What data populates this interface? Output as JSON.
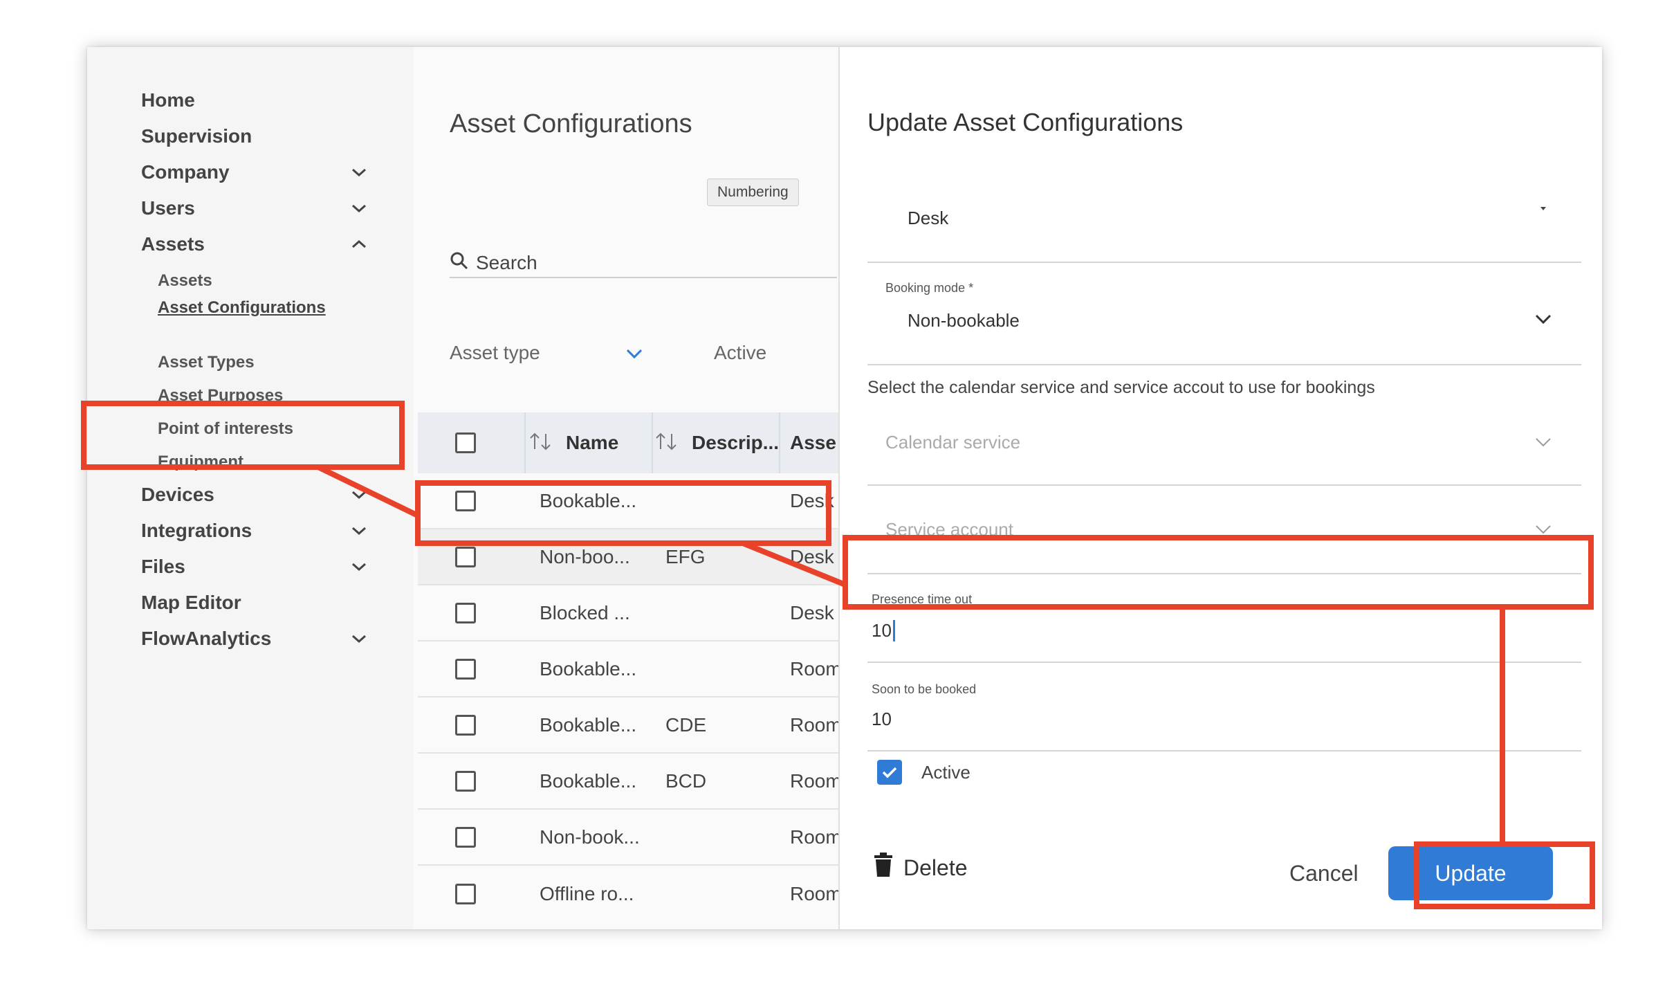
{
  "sidebar": {
    "items": [
      {
        "label": "Home"
      },
      {
        "label": "Supervision"
      },
      {
        "label": "Company"
      },
      {
        "label": "Users"
      },
      {
        "label": "Assets"
      },
      {
        "label": "Devices"
      },
      {
        "label": "Integrations"
      },
      {
        "label": "Files"
      },
      {
        "label": "Map Editor"
      },
      {
        "label": "FlowAnalytics"
      }
    ],
    "asset_sub_items": [
      {
        "label": "Assets"
      },
      {
        "label": "Asset Configurations"
      },
      {
        "label": "Asset Types"
      },
      {
        "label": "Asset Purposes"
      },
      {
        "label": "Point of interests"
      },
      {
        "label": "Equipment"
      }
    ]
  },
  "list": {
    "title": "Asset Configurations",
    "tooltip": "Numbering",
    "search_placeholder": "Search",
    "filters": {
      "asset_type": "Asset type",
      "active": "Active"
    },
    "columns": [
      "Name",
      "Descrip...",
      "Asse"
    ],
    "rows": [
      {
        "name": "Bookable...",
        "desc": "",
        "type": "Desk"
      },
      {
        "name": "Non-boo...",
        "desc": "EFG",
        "type": "Desk"
      },
      {
        "name": "Blocked ...",
        "desc": "",
        "type": "Desk"
      },
      {
        "name": "Bookable...",
        "desc": "",
        "type": "Room"
      },
      {
        "name": "Bookable...",
        "desc": "CDE",
        "type": "Room"
      },
      {
        "name": "Bookable...",
        "desc": "BCD",
        "type": "Room"
      },
      {
        "name": "Non-book...",
        "desc": "",
        "type": "Room"
      },
      {
        "name": "Offline ro...",
        "desc": "",
        "type": "Room"
      }
    ]
  },
  "panel": {
    "title": "Update Asset Configurations",
    "asset_type_value": "Desk",
    "booking_mode": {
      "label": "Booking mode *",
      "value": "Non-bookable"
    },
    "calendar_note": "Select the calendar service and service accout to use for bookings",
    "calendar_service_placeholder": "Calendar service",
    "service_account_placeholder": "Service account",
    "presence_timeout": {
      "label": "Presence time out",
      "value": "10"
    },
    "soon_to_be_booked": {
      "label": "Soon to be booked",
      "value": "10"
    },
    "active_label": "Active",
    "delete_label": "Delete",
    "cancel_label": "Cancel",
    "update_label": "Update"
  },
  "colors": {
    "accent": "#2f7bd6",
    "highlight": "#e8432a"
  }
}
